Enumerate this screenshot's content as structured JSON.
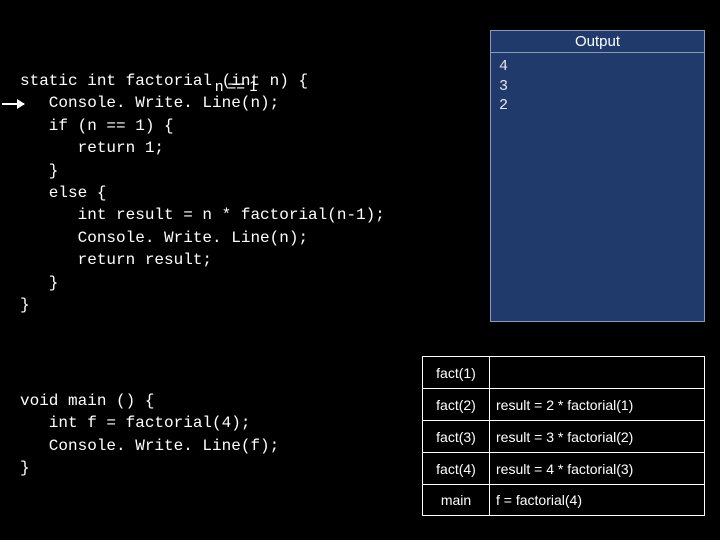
{
  "condition_label": "n == 1",
  "code_factorial": "static int factorial (int n) {\n   Console. Write. Line(n);\n   if (n == 1) {\n      return 1;\n   }\n   else {\n      int result = n * factorial(n-1);\n      Console. Write. Line(n);\n      return result;\n   }\n}",
  "code_main": "void main () {\n   int f = factorial(4);\n   Console. Write. Line(f);\n}",
  "output": {
    "title": "Output",
    "lines": "4\n3\n2"
  },
  "stack": [
    {
      "label": "fact(1)",
      "value": ""
    },
    {
      "label": "fact(2)",
      "value": "result = 2 * factorial(1)"
    },
    {
      "label": "fact(3)",
      "value": "result = 3 * factorial(2)"
    },
    {
      "label": "fact(4)",
      "value": "result = 4 * factorial(3)"
    },
    {
      "label": "main",
      "value": "f = factorial(4)"
    }
  ]
}
